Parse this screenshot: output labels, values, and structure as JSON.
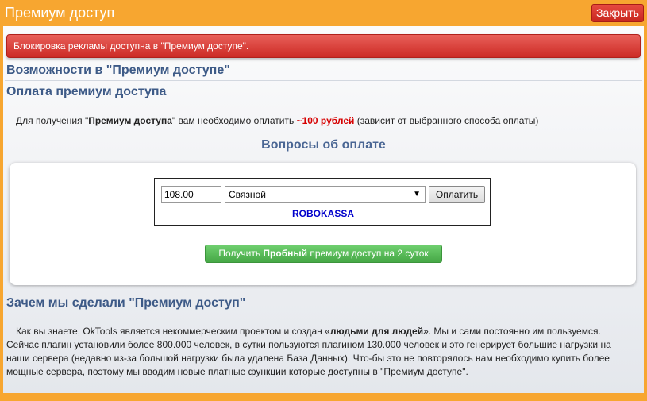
{
  "window": {
    "title": "Премиум доступ",
    "close_label": "Закрыть"
  },
  "alert": {
    "text": "Блокировка рекламы доступна в \"Премиум доступе\"."
  },
  "sections": {
    "features_title": "Возможности в \"Премиум доступе\"",
    "payment_title": "Оплата премиум доступа"
  },
  "intro": {
    "part1": "Для получения \"",
    "bold_name": "Премиум доступа",
    "part2": "\" вам необходимо оплатить ",
    "price": "~100 рублей",
    "part3": " (зависит от выбранного способа оплаты)"
  },
  "faq": {
    "title": "Вопросы об оплате"
  },
  "payform": {
    "amount_value": "108.00",
    "method_selected": "Связной",
    "pay_label": "Оплатить",
    "provider_link": "ROBOKASSA"
  },
  "trial": {
    "prefix": "Получить ",
    "bold": "Пробный",
    "suffix": " премиум доступ на 2 суток"
  },
  "why": {
    "title": "Зачем мы сделали \"Премиум доступ\"",
    "p1": "Как вы знаете, OkTools является некоммерческим проектом и создан «",
    "p_bold": "людьми для людей",
    "p2": "». Мы и сами постоянно им пользуемся. Сейчас плагин установили более 800.000 человек, в сутки пользуются плагином 130.000 человек и это генерирует большие нагрузки на наши сервера (недавно из-за большой нагрузки была удалена База Данных). Что-бы это не повторялось нам необходимо купить более мощные сервера, поэтому мы вводим новые платные функции которые доступны в \"Премиум доступе\"."
  },
  "colors": {
    "frame_orange": "#f7a630",
    "heading_blue": "#3d5a87",
    "alert_red": "#cc2b25",
    "price_red": "#d60000",
    "trial_green": "#46a846",
    "link_blue": "#0000cc"
  },
  "icons": {
    "select_arrow": "chevron-down-icon"
  }
}
